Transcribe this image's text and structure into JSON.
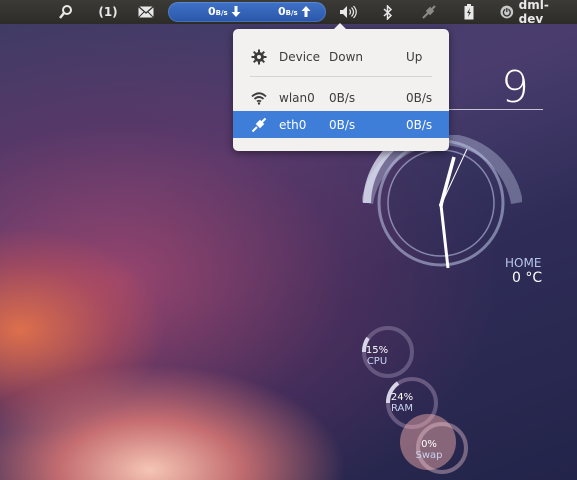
{
  "panel": {
    "unread_count": "(1)",
    "net_down_value": "0",
    "net_down_unit": "B/s",
    "net_up_value": "0",
    "net_up_unit": "B/s",
    "username": "dml-dev",
    "icons": [
      "search-people-icon",
      "mail-icon",
      "download-arrow-icon",
      "upload-arrow-icon",
      "volume-icon",
      "bluetooth-icon",
      "network-plug-icon",
      "battery-icon",
      "power-icon"
    ]
  },
  "net_popup": {
    "headers": {
      "device": "Device",
      "down": "Down",
      "up": "Up"
    },
    "rows": [
      {
        "device": "wlan0",
        "down": "0B/s",
        "up": "0B/s",
        "icon": "wifi-icon",
        "selected": false
      },
      {
        "device": "eth0",
        "down": "0B/s",
        "up": "0B/s",
        "icon": "ethernet-plug-icon",
        "selected": true
      }
    ]
  },
  "desktop": {
    "clock_digit": "9",
    "weather_location": "HOME",
    "temperature": "0 °C",
    "gauges": [
      {
        "value": "15%",
        "label": "CPU",
        "fraction": 0.15
      },
      {
        "value": "24%",
        "label": "RAM",
        "fraction": 0.24
      },
      {
        "value": "0%",
        "label": "Swap",
        "fraction": 0.0
      }
    ]
  },
  "colors": {
    "accent": "#3f7ed8",
    "panel": "#33322f",
    "popup_bg": "#f2f1f0"
  }
}
